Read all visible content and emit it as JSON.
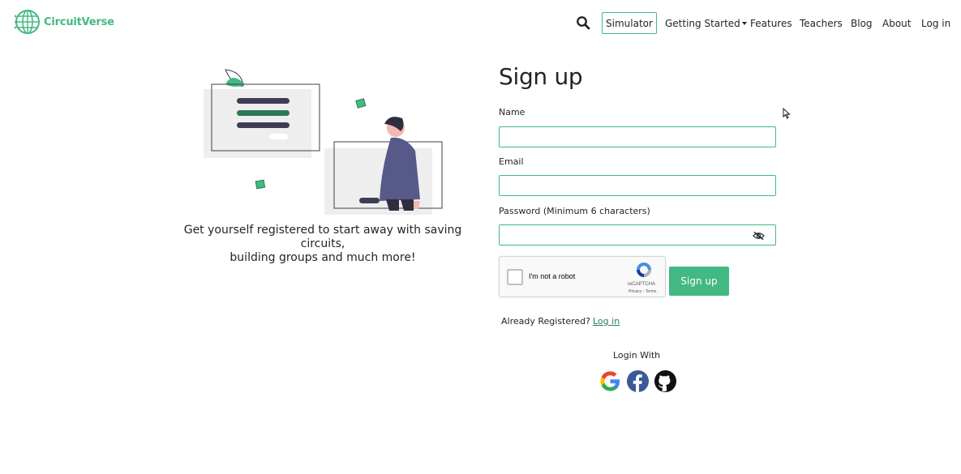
{
  "brand": {
    "name": "CircuitVerse",
    "color": "#42b983"
  },
  "nav": {
    "search_icon": "search-icon",
    "simulator": "Simulator",
    "getting_started": "Getting Started",
    "features": "Features",
    "teachers": "Teachers",
    "blog": "Blog",
    "about": "About",
    "login": "Log in"
  },
  "left": {
    "tagline_line1": "Get yourself registered to start away with saving circuits,",
    "tagline_line2": "building groups and much more!"
  },
  "form": {
    "title": "Sign up",
    "name_label": "Name",
    "name_value": "",
    "email_label": "Email",
    "email_value": "",
    "password_label": "Password (Minimum 6 characters)",
    "password_value": "",
    "recaptcha_text": "I'm not a robot",
    "recaptcha_brand": "reCAPTCHA",
    "recaptcha_links": "Privacy - Terms",
    "submit": "Sign up",
    "already_text": "Already Registered?",
    "already_link": "Log in",
    "login_with": "Login With"
  },
  "social": [
    "google-icon",
    "facebook-icon",
    "github-icon"
  ],
  "colors": {
    "accent": "#42b983",
    "dark_bar": "#3f3d56",
    "green_bar": "#2c7a55"
  }
}
